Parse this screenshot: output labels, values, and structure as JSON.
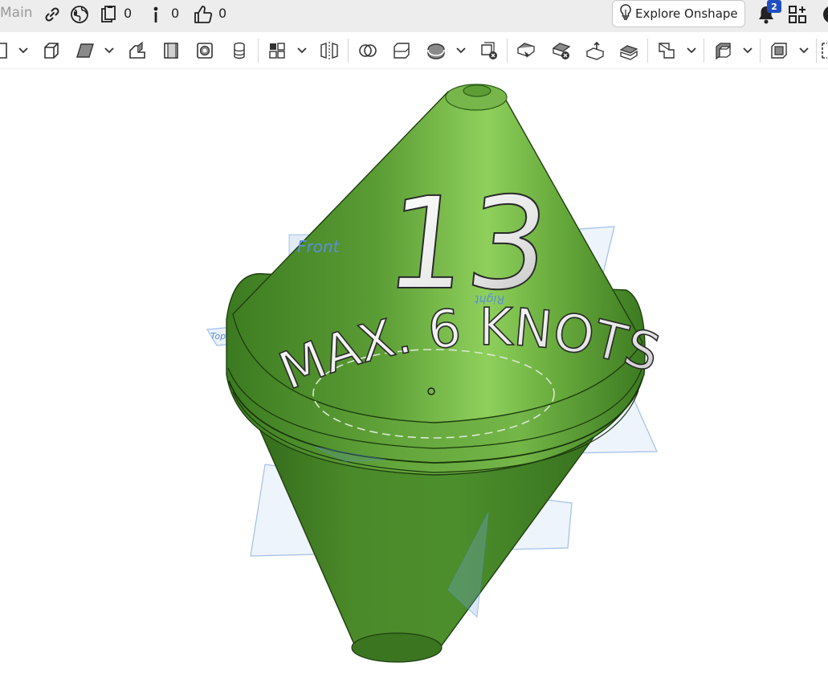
{
  "header": {
    "branch_label": "Main",
    "copies_count": "0",
    "versions_count": "0",
    "likes_count": "0",
    "explore_label": "Explore Onshape",
    "notification_count": "2"
  },
  "icons": {
    "link": "link-icon",
    "public": "globe-icon",
    "copies": "clipboard-icon",
    "versions": "info-icon",
    "likes": "thumbs-up-icon",
    "explore": "lightbulb-icon",
    "notifications": "bell-icon",
    "apps": "add-apps-icon"
  },
  "model": {
    "number_label": "13",
    "speed_label": "MAX. 6 KNOTS",
    "plane_front_label": "Front",
    "plane_right_label": "Right",
    "plane_top_label": "Top",
    "body_color": "#4c8e2c",
    "highlight_color": "#7fbf4e",
    "shadow_color": "#2f6418",
    "plane_color": "#5b8fd6"
  }
}
